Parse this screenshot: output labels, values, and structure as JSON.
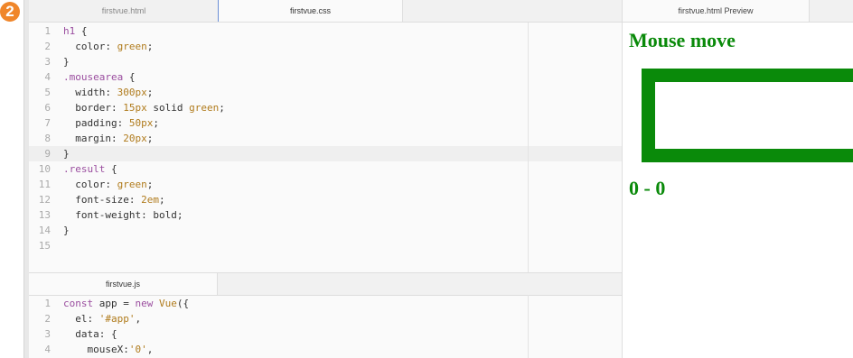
{
  "badge": {
    "number": "2"
  },
  "tabs_top": [
    "firstvue.html",
    "firstvue.css"
  ],
  "tabs_bottom": [
    "firstvue.js"
  ],
  "preview": {
    "tab_label": "firstvue.html Preview",
    "heading": "Mouse move",
    "result": "0 - 0"
  },
  "css_lines": [
    {
      "n": "1",
      "seg": [
        {
          "c": "sel",
          "t": "h1"
        },
        {
          "c": "fn",
          "t": " {"
        }
      ]
    },
    {
      "n": "2",
      "seg": [
        {
          "c": "fn",
          "t": "  color: "
        },
        {
          "c": "val",
          "t": "green"
        },
        {
          "c": "fn",
          "t": ";"
        }
      ]
    },
    {
      "n": "3",
      "seg": [
        {
          "c": "fn",
          "t": "}"
        }
      ]
    },
    {
      "n": "4",
      "seg": [
        {
          "c": "sel",
          "t": ".mousearea"
        },
        {
          "c": "fn",
          "t": " {"
        }
      ]
    },
    {
      "n": "5",
      "seg": [
        {
          "c": "fn",
          "t": "  width: "
        },
        {
          "c": "val",
          "t": "300px"
        },
        {
          "c": "fn",
          "t": ";"
        }
      ]
    },
    {
      "n": "6",
      "seg": [
        {
          "c": "fn",
          "t": "  border: "
        },
        {
          "c": "val",
          "t": "15px"
        },
        {
          "c": "fn",
          "t": " solid "
        },
        {
          "c": "val",
          "t": "green"
        },
        {
          "c": "fn",
          "t": ";"
        }
      ]
    },
    {
      "n": "7",
      "seg": [
        {
          "c": "fn",
          "t": "  padding: "
        },
        {
          "c": "val",
          "t": "50px"
        },
        {
          "c": "fn",
          "t": ";"
        }
      ]
    },
    {
      "n": "8",
      "seg": [
        {
          "c": "fn",
          "t": "  margin: "
        },
        {
          "c": "val",
          "t": "20px"
        },
        {
          "c": "fn",
          "t": ";"
        }
      ]
    },
    {
      "n": "9",
      "seg": [
        {
          "c": "fn",
          "t": "}"
        }
      ],
      "hl": true
    },
    {
      "n": "10",
      "seg": [
        {
          "c": "sel",
          "t": ".result"
        },
        {
          "c": "fn",
          "t": " {"
        }
      ]
    },
    {
      "n": "11",
      "seg": [
        {
          "c": "fn",
          "t": "  color: "
        },
        {
          "c": "val",
          "t": "green"
        },
        {
          "c": "fn",
          "t": ";"
        }
      ]
    },
    {
      "n": "12",
      "seg": [
        {
          "c": "fn",
          "t": "  font-size: "
        },
        {
          "c": "val",
          "t": "2em"
        },
        {
          "c": "fn",
          "t": ";"
        }
      ]
    },
    {
      "n": "13",
      "seg": [
        {
          "c": "fn",
          "t": "  font-weight: bold;"
        }
      ]
    },
    {
      "n": "14",
      "seg": [
        {
          "c": "fn",
          "t": "}"
        }
      ]
    },
    {
      "n": "15",
      "seg": []
    }
  ],
  "js_lines": [
    {
      "n": "1",
      "seg": [
        {
          "c": "kw",
          "t": "const"
        },
        {
          "c": "fn",
          "t": " app = "
        },
        {
          "c": "kw",
          "t": "new"
        },
        {
          "c": "fn",
          "t": " "
        },
        {
          "c": "val",
          "t": "Vue"
        },
        {
          "c": "fn",
          "t": "({"
        }
      ]
    },
    {
      "n": "2",
      "seg": [
        {
          "c": "fn",
          "t": "  el: "
        },
        {
          "c": "str",
          "t": "'#app'"
        },
        {
          "c": "fn",
          "t": ","
        }
      ]
    },
    {
      "n": "3",
      "seg": [
        {
          "c": "fn",
          "t": "  data: {"
        }
      ]
    },
    {
      "n": "4",
      "seg": [
        {
          "c": "fn",
          "t": "    mouseX:"
        },
        {
          "c": "str",
          "t": "'0'"
        },
        {
          "c": "fn",
          "t": ","
        }
      ]
    }
  ],
  "colors": {
    "green": "#0a8a0a",
    "badge": "#f0862a",
    "selector": "#9a4d9f",
    "value": "#b07b1c"
  }
}
